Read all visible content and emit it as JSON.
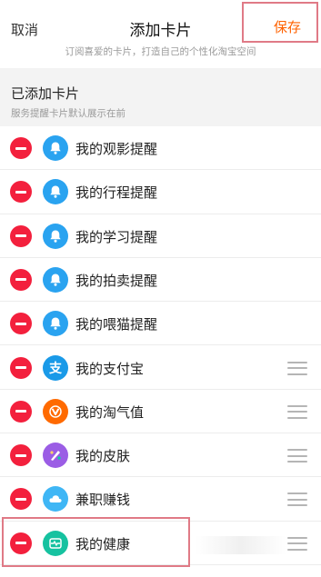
{
  "header": {
    "cancel_label": "取消",
    "title": "添加卡片",
    "subtitle": "订阅喜爱的卡片，打造自己的个性化淘宝空间",
    "save_label": "保存"
  },
  "section": {
    "title": "已添加卡片",
    "subtitle": "服务提醒卡片默认展示在前"
  },
  "cards": [
    {
      "label": "我的观影提醒",
      "icon": "bell-icon",
      "color": "#2aa3f0",
      "draggable": false
    },
    {
      "label": "我的行程提醒",
      "icon": "bell-icon",
      "color": "#2aa3f0",
      "draggable": false
    },
    {
      "label": "我的学习提醒",
      "icon": "bell-icon",
      "color": "#2aa3f0",
      "draggable": false
    },
    {
      "label": "我的拍卖提醒",
      "icon": "bell-icon",
      "color": "#2aa3f0",
      "draggable": false
    },
    {
      "label": "我的喂猫提醒",
      "icon": "bell-icon",
      "color": "#2aa3f0",
      "draggable": false
    },
    {
      "label": "我的支付宝",
      "icon": "alipay-icon",
      "color": "#1a9ae8",
      "draggable": true
    },
    {
      "label": "我的淘气值",
      "icon": "taoqi-icon",
      "color": "#ff6a00",
      "draggable": true
    },
    {
      "label": "我的皮肤",
      "icon": "palette-icon",
      "color": "#9b5de5",
      "draggable": true
    },
    {
      "label": "兼职赚钱",
      "icon": "cloud-icon",
      "color": "#3fb6f5",
      "draggable": true
    },
    {
      "label": "我的健康",
      "icon": "health-icon",
      "color": "#16c2a0",
      "draggable": true
    }
  ],
  "colors": {
    "accent": "#ff6200",
    "remove": "#f3203d",
    "highlight": "#e07a86"
  }
}
